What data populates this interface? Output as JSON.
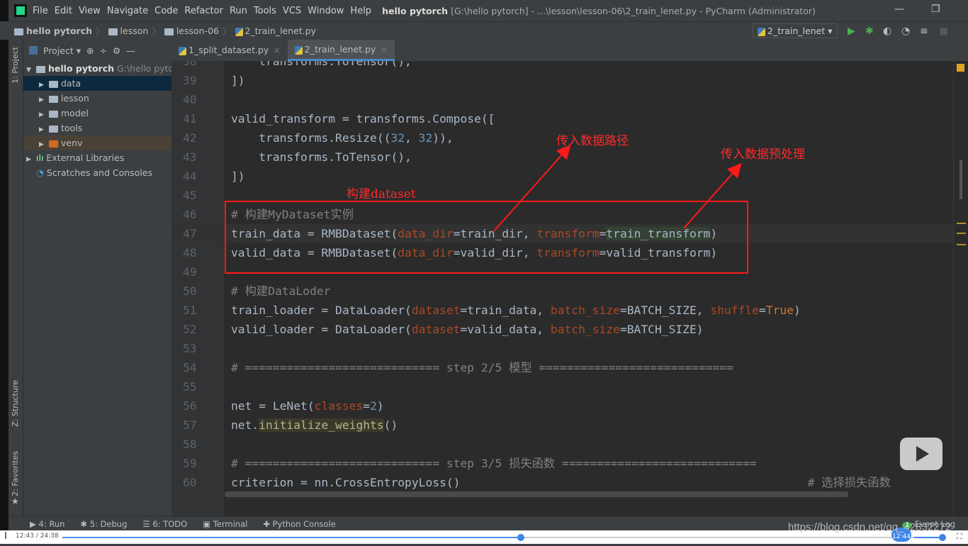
{
  "titlebar": {
    "menu": [
      "File",
      "Edit",
      "View",
      "Navigate",
      "Code",
      "Refactor",
      "Run",
      "Tools",
      "VCS",
      "Window",
      "Help"
    ],
    "project": "hello pytorch",
    "title": "[G:\\hello pytorch] - ...\\lesson\\lesson-06\\2_train_lenet.py - PyCharm (Administrator)"
  },
  "breadcrumb": [
    "hello pytorch",
    "lesson",
    "lesson-06",
    "2_train_lenet.py"
  ],
  "run_config": "2_train_lenet",
  "project_panel": {
    "title": "Project",
    "root": "hello pytorch",
    "root_path": "G:\\hello pytor",
    "items": [
      "data",
      "lesson",
      "model",
      "tools",
      "venv"
    ],
    "external": "External Libraries",
    "scratches": "Scratches and Consoles",
    "selected": "data"
  },
  "tool_strips": {
    "project": "1: Project",
    "structure": "Z: Structure",
    "favorites": "2: Favorites"
  },
  "tabs": [
    {
      "label": "1_split_dataset.py",
      "active": false
    },
    {
      "label": "2_train_lenet.py",
      "active": true
    }
  ],
  "code": [
    {
      "n": "38",
      "t": [
        [
          "    transforms.ToTensor(),",
          ""
        ]
      ]
    },
    {
      "n": "39",
      "t": [
        [
          "])",
          ""
        ]
      ]
    },
    {
      "n": "40",
      "t": []
    },
    {
      "n": "41",
      "t": [
        [
          "valid_transform = transforms.Compose([",
          ""
        ]
      ]
    },
    {
      "n": "42",
      "t": [
        [
          "    transforms.Resize((",
          ""
        ],
        [
          "32",
          "n"
        ],
        [
          ", ",
          ""
        ],
        [
          "32",
          "n"
        ],
        [
          ")),",
          ""
        ]
      ]
    },
    {
      "n": "43",
      "t": [
        [
          "    transforms.ToTensor(),",
          ""
        ]
      ]
    },
    {
      "n": "44",
      "t": [
        [
          "])",
          ""
        ]
      ]
    },
    {
      "n": "45",
      "t": []
    },
    {
      "n": "46",
      "t": [
        [
          "# 构建MyDataset实例",
          "c"
        ]
      ]
    },
    {
      "n": "47",
      "t": [
        [
          "train_data = RMBDataset(",
          ""
        ],
        [
          "data_dir",
          "p"
        ],
        [
          "=train_dir, ",
          ""
        ],
        [
          "transform",
          "p"
        ],
        [
          "=",
          ""
        ],
        [
          "train_transform",
          "hl"
        ],
        [
          ")",
          ""
        ]
      ]
    },
    {
      "n": "48",
      "t": [
        [
          "valid_data = RMBDataset(",
          ""
        ],
        [
          "data_dir",
          "p"
        ],
        [
          "=valid_dir, ",
          ""
        ],
        [
          "transform",
          "p"
        ],
        [
          "=valid_transform)",
          ""
        ]
      ]
    },
    {
      "n": "49",
      "t": []
    },
    {
      "n": "50",
      "t": [
        [
          "# 构建DataLoder",
          "c"
        ]
      ]
    },
    {
      "n": "51",
      "t": [
        [
          "train_loader = DataLoader(",
          ""
        ],
        [
          "dataset",
          "p"
        ],
        [
          "=train_data, ",
          ""
        ],
        [
          "batch_size",
          "p"
        ],
        [
          "=BATCH_SIZE, ",
          ""
        ],
        [
          "shuffle",
          "p"
        ],
        [
          "=",
          ""
        ],
        [
          "True",
          "k"
        ],
        [
          ")",
          ""
        ]
      ]
    },
    {
      "n": "52",
      "t": [
        [
          "valid_loader = DataLoader(",
          ""
        ],
        [
          "dataset",
          "p"
        ],
        [
          "=valid_data, ",
          ""
        ],
        [
          "batch_size",
          "p"
        ],
        [
          "=BATCH_SIZE)",
          ""
        ]
      ]
    },
    {
      "n": "53",
      "t": []
    },
    {
      "n": "54",
      "t": [
        [
          "# ============================ step 2/5 模型 ============================",
          "c"
        ]
      ]
    },
    {
      "n": "55",
      "t": []
    },
    {
      "n": "56",
      "t": [
        [
          "net = LeNet(",
          ""
        ],
        [
          "classes",
          "p"
        ],
        [
          "=",
          ""
        ],
        [
          "2",
          "n"
        ],
        [
          ")",
          ""
        ]
      ]
    },
    {
      "n": "57",
      "t": [
        [
          "net.",
          ""
        ],
        [
          "initialize_weights",
          "f"
        ],
        [
          "()",
          ""
        ]
      ]
    },
    {
      "n": "58",
      "t": []
    },
    {
      "n": "59",
      "t": [
        [
          "# ============================ step 3/5 损失函数 ============================",
          "c"
        ]
      ]
    },
    {
      "n": "60",
      "t": [
        [
          "criterion = nn.CrossEntropyLoss()                                                  ",
          ""
        ],
        [
          "# 选择损失函数",
          "c"
        ]
      ]
    }
  ],
  "annotations": {
    "dataset": "构建dataset",
    "data_dir": "传入数据路径",
    "transform": "传入数据预处理"
  },
  "bottom_tools": [
    "4: Run",
    "5: Debug",
    "6: TODO",
    "Terminal",
    "Python Console"
  ],
  "event_log": {
    "label": "Event Log",
    "count": "1"
  },
  "video": {
    "time": "12:43 / 24:38",
    "progress": 0.52,
    "hover_time": "12:44",
    "volume": 1.0
  },
  "watermark": "https://blog.csdn.net/qq_42832272",
  "colors": {
    "editor_bg": "#2b2b2b",
    "keyword": "#cc7832",
    "param": "#aa4926",
    "number": "#6897bb",
    "comment": "#808080",
    "annotation": "#ff1a1a"
  }
}
